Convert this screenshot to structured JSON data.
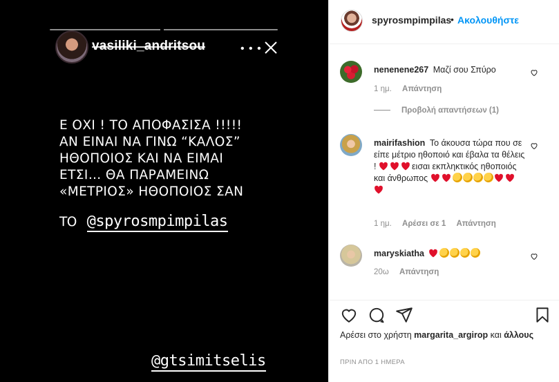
{
  "story": {
    "username": "vasiliki_andritsou",
    "more_icon": "ellipsis-icon",
    "close_icon": "close-icon",
    "text_lines": [
      "Ε  ΟΧΙ ! ΤΟ ΑΠΟΦΑΣΙΣΑ !!!!!",
      "ΑΝ ΕΙΝΑΙ ΝΑ ΓΙΝΩ “ΚΑΛΟΣ”",
      "ΗΘΟΠΟΙΟΣ ΚΑΙ ΝΑ ΕΙΜΑΙ",
      "ΕΤΣΙ… ΘΑ ΠΑΡΑΜΕΙΝΩ",
      "«ΜΕΤΡΙΟΣ» ΗΘΟΠΟΙΟΣ ΣΑΝ"
    ],
    "mention_prefix": "ΤΟ",
    "mention_primary": "@spyrosmpimpilas",
    "mention_secondary": "@gtsimitselis"
  },
  "post_header": {
    "username": "spyrosmpimpilas",
    "separator": "•",
    "follow_label": "Ακολουθήστε"
  },
  "comments": [
    {
      "username": "nenenene267",
      "text": "Μαζί σου Σπύρο",
      "age": "1 ημ.",
      "reply_label": "Απάντηση",
      "likes_label": ""
    },
    {
      "username": "mairifashion",
      "text_part1": "Το άκουσα τώρα που σε είπε μέτριο ηθοποιό και έβαλα τα θέλεις !",
      "text_part2": "εισαι εκπληκτικός ηθοποιός και άνθρωπος",
      "age": "1 ημ.",
      "likes_label": "Αρέσει σε 1",
      "reply_label": "Απάντηση"
    },
    {
      "username": "maryskiatha",
      "text": "",
      "age": "20ω",
      "reply_label": "Απάντηση"
    }
  ],
  "view_replies_label": "Προβολή απαντήσεων (1)",
  "actions": {
    "like_icon": "heart-icon",
    "comment_icon": "comment-icon",
    "share_icon": "share-icon",
    "save_icon": "bookmark-icon"
  },
  "likes": {
    "prefix": "Αρέσει στο χρήστη",
    "user": "margarita_argirop",
    "suffix": "και",
    "others": "άλλους"
  },
  "timestamp": "ΠΡΙΝ ΑΠΟ 1 ΗΜΕΡΑ",
  "colors": {
    "accent": "#0095f6",
    "text": "#262626",
    "muted": "#8e8e8e",
    "heart_emoji": "#e0102b"
  }
}
